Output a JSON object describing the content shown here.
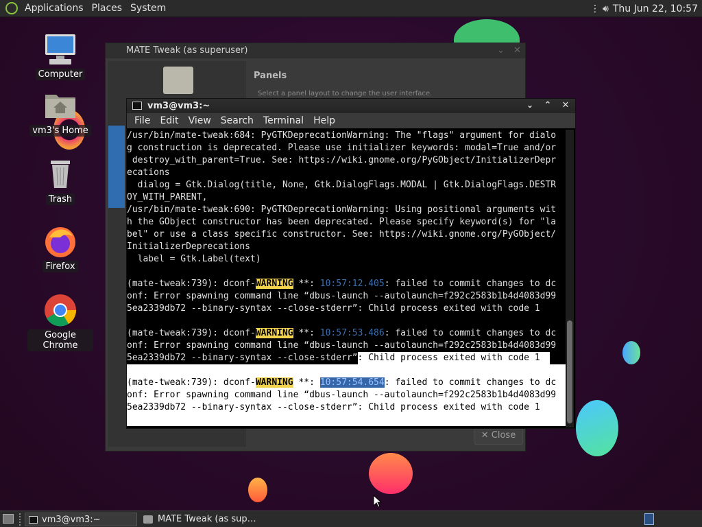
{
  "top_panel": {
    "menus": [
      "Applications",
      "Places",
      "System"
    ],
    "clock": "Thu Jun 22, 10:57"
  },
  "desktop_icons": [
    {
      "label": "Computer",
      "icon": "computer-icon"
    },
    {
      "label": "vm3's Home",
      "icon": "home-folder-icon"
    },
    {
      "label": "Trash",
      "icon": "trash-icon"
    },
    {
      "label": "Firefox",
      "icon": "firefox-icon"
    },
    {
      "label": "Google Chrome",
      "icon": "chrome-icon"
    }
  ],
  "tweak_window": {
    "title": "MATE Tweak (as superuser)",
    "section_title": "Panels",
    "section_subtitle": "Select a panel layout to change the user interface.",
    "close_label": "✕ Close"
  },
  "terminal": {
    "title": "vm3@vm3:~",
    "menu": [
      "File",
      "Edit",
      "View",
      "Search",
      "Terminal",
      "Help"
    ],
    "lines": [
      "/usr/bin/mate-tweak:684: PyGTKDeprecationWarning: The \"flags\" argument for dialo",
      "g construction is deprecated. Please use initializer keywords: modal=True and/or",
      " destroy_with_parent=True. See: https://wiki.gnome.org/PyGObject/InitializerDepr",
      "ecations",
      "  dialog = Gtk.Dialog(title, None, Gtk.DialogFlags.MODAL | Gtk.DialogFlags.DESTR",
      "OY_WITH_PARENT,",
      "/usr/bin/mate-tweak:690: PyGTKDeprecationWarning: Using positional arguments wit",
      "h the GObject constructor has been deprecated. Please specify keyword(s) for \"la",
      "bel\" or use a class specific constructor. See: https://wiki.gnome.org/PyGObject/",
      "InitializerDeprecations",
      "  label = Gtk.Label(text)",
      ""
    ],
    "warnings": [
      {
        "prefix": "(mate-tweak:739): dconf-",
        "level": "WARNING",
        "stars": " **: ",
        "time": "10:57:12.405",
        "rest1": ": failed to commit changes to dc",
        "rest2": "onf: Error spawning command line “dbus-launch --autolaunch=f292c2583b1b4d4083d99",
        "rest3": "5ea2339db72 --binary-syntax --close-stderr”: Child process exited with code 1"
      },
      {
        "prefix": "(mate-tweak:739): dconf-",
        "level": "WARNING",
        "stars": " **: ",
        "time": "10:57:53.486",
        "rest1": ": failed to commit changes to dc",
        "rest2": "onf: Error spawning command line “dbus-launch --autolaunch=f292c2583b1b4d4083d99",
        "rest3": "5ea2339db72 --binary-syntax --close-stderr”",
        "rest3b": ": Child process exited with code 1"
      },
      {
        "prefix": "(mate-tweak:739): dconf-",
        "level": "WARNING",
        "stars": " **: ",
        "time": "10:57:54.654",
        "rest1": ": failed to commit changes to dc",
        "rest2": "onf: Error spawning command line “dbus-launch --autolaunch=f292c2583b1b4d4083d99",
        "rest3": "5ea2339db72 --binary-syntax --close-stderr”: Child process exited with code 1"
      }
    ]
  },
  "taskbar": {
    "tasks": [
      "vm3@vm3:~",
      "MATE Tweak (as sup…"
    ]
  }
}
